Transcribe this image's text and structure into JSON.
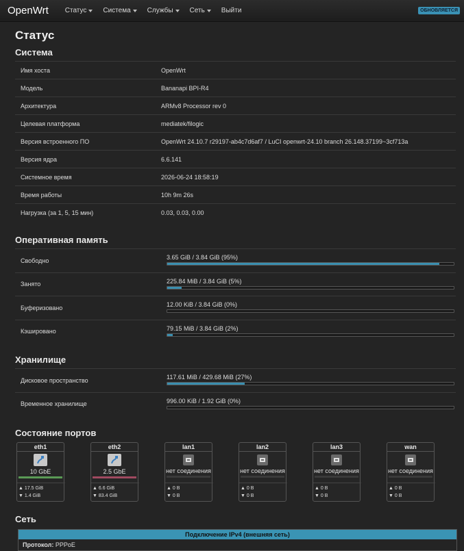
{
  "nav": {
    "brand": "OpenWrt",
    "items": [
      {
        "label": "Статус"
      },
      {
        "label": "Система"
      },
      {
        "label": "Службы"
      },
      {
        "label": "Сеть"
      },
      {
        "label": "Выйти"
      }
    ],
    "badge": "ОБНОВЛЯЕТСЯ"
  },
  "page_title": "Статус",
  "system": {
    "heading": "Система",
    "rows": [
      {
        "key": "Имя хоста",
        "value": "OpenWrt"
      },
      {
        "key": "Модель",
        "value": "Bananapi BPI-R4"
      },
      {
        "key": "Архитектура",
        "value": "ARMv8 Processor rev 0"
      },
      {
        "key": "Целевая платформа",
        "value": "mediatek/filogic"
      },
      {
        "key": "Версия встроенного ПО",
        "value": "OpenWrt 24.10.7 r29197-ab4c7d6af7 / LuCI openwrt-24.10 branch 26.148.37199~3cf713a"
      },
      {
        "key": "Версия ядра",
        "value": "6.6.141"
      },
      {
        "key": "Системное время",
        "value": "2026-06-24 18:58:19"
      },
      {
        "key": "Время работы",
        "value": "10h 9m 26s"
      },
      {
        "key": "Нагрузка (за 1, 5, 15 мин)",
        "value": "0.03, 0.03, 0.00"
      }
    ]
  },
  "memory": {
    "heading": "Оперативная память",
    "rows": [
      {
        "key": "Свободно",
        "value": "3.65 GiB / 3.84 GiB (95%)",
        "percent": 95
      },
      {
        "key": "Занято",
        "value": "225.84 MiB / 3.84 GiB (5%)",
        "percent": 5
      },
      {
        "key": "Буферизовано",
        "value": "12.00 KiB / 3.84 GiB (0%)",
        "percent": 0
      },
      {
        "key": "Кэшировано",
        "value": "79.15 MiB / 3.84 GiB (2%)",
        "percent": 2
      }
    ]
  },
  "storage": {
    "heading": "Хранилище",
    "rows": [
      {
        "key": "Дисковое пространство",
        "value": "117.61 MiB / 429.68 MiB (27%)",
        "percent": 27
      },
      {
        "key": "Временное хранилище",
        "value": "996.00 KiB / 1.92 GiB (0%)",
        "percent": 0
      }
    ]
  },
  "ports": {
    "heading": "Состояние портов",
    "items": [
      {
        "name": "eth1",
        "status": "10 GbE",
        "up": true,
        "line_color": "#5a9a55",
        "tx": "▲ 17.5 GiB",
        "rx": "▼ 1.4 GiB"
      },
      {
        "name": "eth2",
        "status": "2.5 GbE",
        "up": true,
        "line_color": "#a04a60",
        "tx": "▲ 6.6 GiB",
        "rx": "▼ 83.4 GiB"
      },
      {
        "name": "lan1",
        "status": "нет соединения",
        "up": false,
        "line_color": "#3a3a3a",
        "tx": "▲ 0 B",
        "rx": "▼ 0 B"
      },
      {
        "name": "lan2",
        "status": "нет соединения",
        "up": false,
        "line_color": "#3a3a3a",
        "tx": "▲ 0 B",
        "rx": "▼ 0 B"
      },
      {
        "name": "lan3",
        "status": "нет соединения",
        "up": false,
        "line_color": "#3a3a3a",
        "tx": "▲ 0 B",
        "rx": "▼ 0 B"
      },
      {
        "name": "wan",
        "status": "нет соединения",
        "up": false,
        "line_color": "#3a3a3a",
        "tx": "▲ 0 B",
        "rx": "▼ 0 B"
      }
    ]
  },
  "network": {
    "heading": "Сеть",
    "box_title": "Подключение IPv4 (внешняя сеть)",
    "protocol_label": "Протокол:",
    "protocol_value": "PPPoE"
  }
}
